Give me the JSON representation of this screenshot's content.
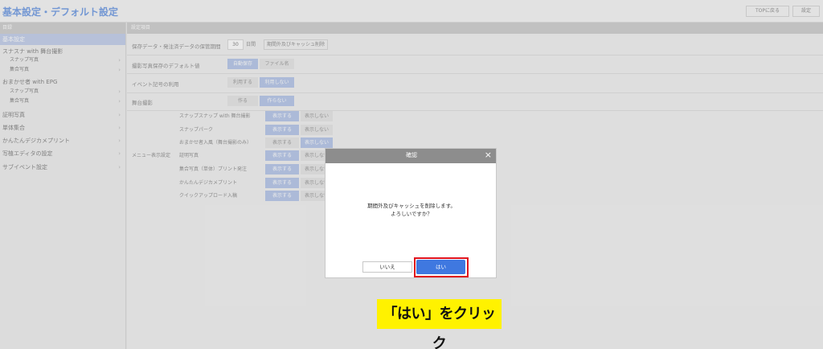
{
  "topbar": {
    "title": "基本設定・デフォルト設定",
    "top_button": "TOPに戻る",
    "settings_button": "設定"
  },
  "sidebar": {
    "header": "目録",
    "items": [
      {
        "label": "基本設定",
        "active": true
      },
      {
        "label": "スナスナ with 舞台撮影",
        "active": false
      },
      {
        "label": "スナップ写真",
        "sub": true
      },
      {
        "label": "集合写真",
        "sub": true
      },
      {
        "label": "おまかせ者 with EPG",
        "active": false
      },
      {
        "label": "スナップ写真",
        "sub": true
      },
      {
        "label": "集合写真",
        "sub": true
      },
      {
        "label": "証明写真"
      },
      {
        "label": "単体集合"
      },
      {
        "label": "かんたんデジカメプリント"
      },
      {
        "label": "写植エディタの設定"
      },
      {
        "label": "サブイベント設定"
      }
    ]
  },
  "main": {
    "header": "設定項目",
    "retention": {
      "label": "保存データ・発注済データの保管期間",
      "value": "30",
      "unit": "日間",
      "clear_button": "期間外及びキャッシュ削除"
    },
    "default_save": {
      "label": "撮影写真保存のデフォルト値",
      "options": [
        "自動保存",
        "ファイル名"
      ]
    },
    "event_use": {
      "label": "イベント記号の利用",
      "options": [
        "利用する",
        "利用しない"
      ]
    },
    "stage": {
      "label": "舞台撮影",
      "options": [
        "作る",
        "作らない"
      ]
    },
    "menu_section": "メニュー表示設定",
    "menu_rows": [
      {
        "label": "スナップスナップ with 舞台撮影",
        "options": [
          "表示する",
          "表示しない"
        ]
      },
      {
        "label": "スナップパーク",
        "options": [
          "表示する",
          "表示しない"
        ]
      },
      {
        "label": "おまかせ者入風（舞台撮影のみ）",
        "options": [
          "表示する",
          "表示しない"
        ]
      },
      {
        "label": "証明写真",
        "options": [
          "表示する",
          "表示しない"
        ]
      },
      {
        "label": "集合写真（単体）プリント発注",
        "options": [
          "表示する",
          "表示しない"
        ]
      },
      {
        "label": "かんたんデジカメプリント",
        "options": [
          "表示する",
          "表示しない"
        ]
      },
      {
        "label": "クイックアップロード入稿",
        "options": [
          "表示する",
          "表示しない"
        ]
      }
    ]
  },
  "dialog": {
    "title": "確認",
    "close": "×",
    "message_line1": "期間外及びキャッシュを削除します。",
    "message_line2": "よろしいですか？",
    "no_button": "いいえ",
    "yes_button": "はい"
  },
  "callout": "「はい」をクリック",
  "colors": {
    "accent": "#3f78e0",
    "highlight": "#e0141e",
    "callout_bg": "#fff200"
  }
}
